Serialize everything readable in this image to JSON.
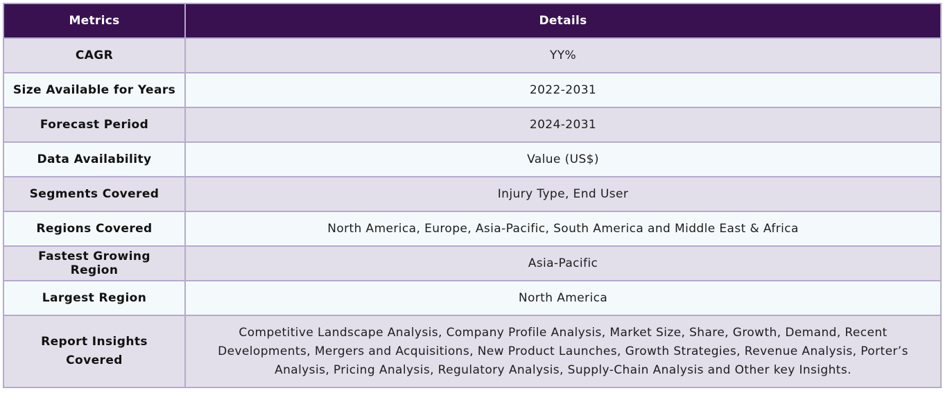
{
  "table": {
    "headers": [
      "Metrics",
      "Details"
    ],
    "rows": [
      {
        "metric": "CAGR",
        "details": "YY%"
      },
      {
        "metric": "Size Available for Years",
        "details": "2022-2031"
      },
      {
        "metric": "Forecast Period",
        "details": "2024-2031"
      },
      {
        "metric": "Data Availability",
        "details": "Value (US$)"
      },
      {
        "metric": "Segments Covered",
        "details": "Injury Type, End User"
      },
      {
        "metric": "Regions Covered",
        "details": "North America, Europe, Asia-Pacific, South America and Middle East & Africa"
      },
      {
        "metric": "Fastest Growing Region",
        "details": "Asia-Pacific"
      },
      {
        "metric": "Largest Region",
        "details": "North America"
      },
      {
        "metric": "Report Insights Covered",
        "details": "Competitive Landscape Analysis, Company Profile Analysis, Market Size, Share, Growth, Demand, Recent Developments, Mergers and Acquisitions, New Product Launches, Growth Strategies, Revenue Analysis, Porter’s Analysis, Pricing Analysis, Regulatory Analysis, Supply-Chain Analysis and Other key Insights."
      }
    ]
  },
  "colors": {
    "header_bg": "#3a1150",
    "row_odd_bg": "#e2dfeb",
    "row_even_bg": "#f4fafc",
    "border": "#b3aacd"
  }
}
